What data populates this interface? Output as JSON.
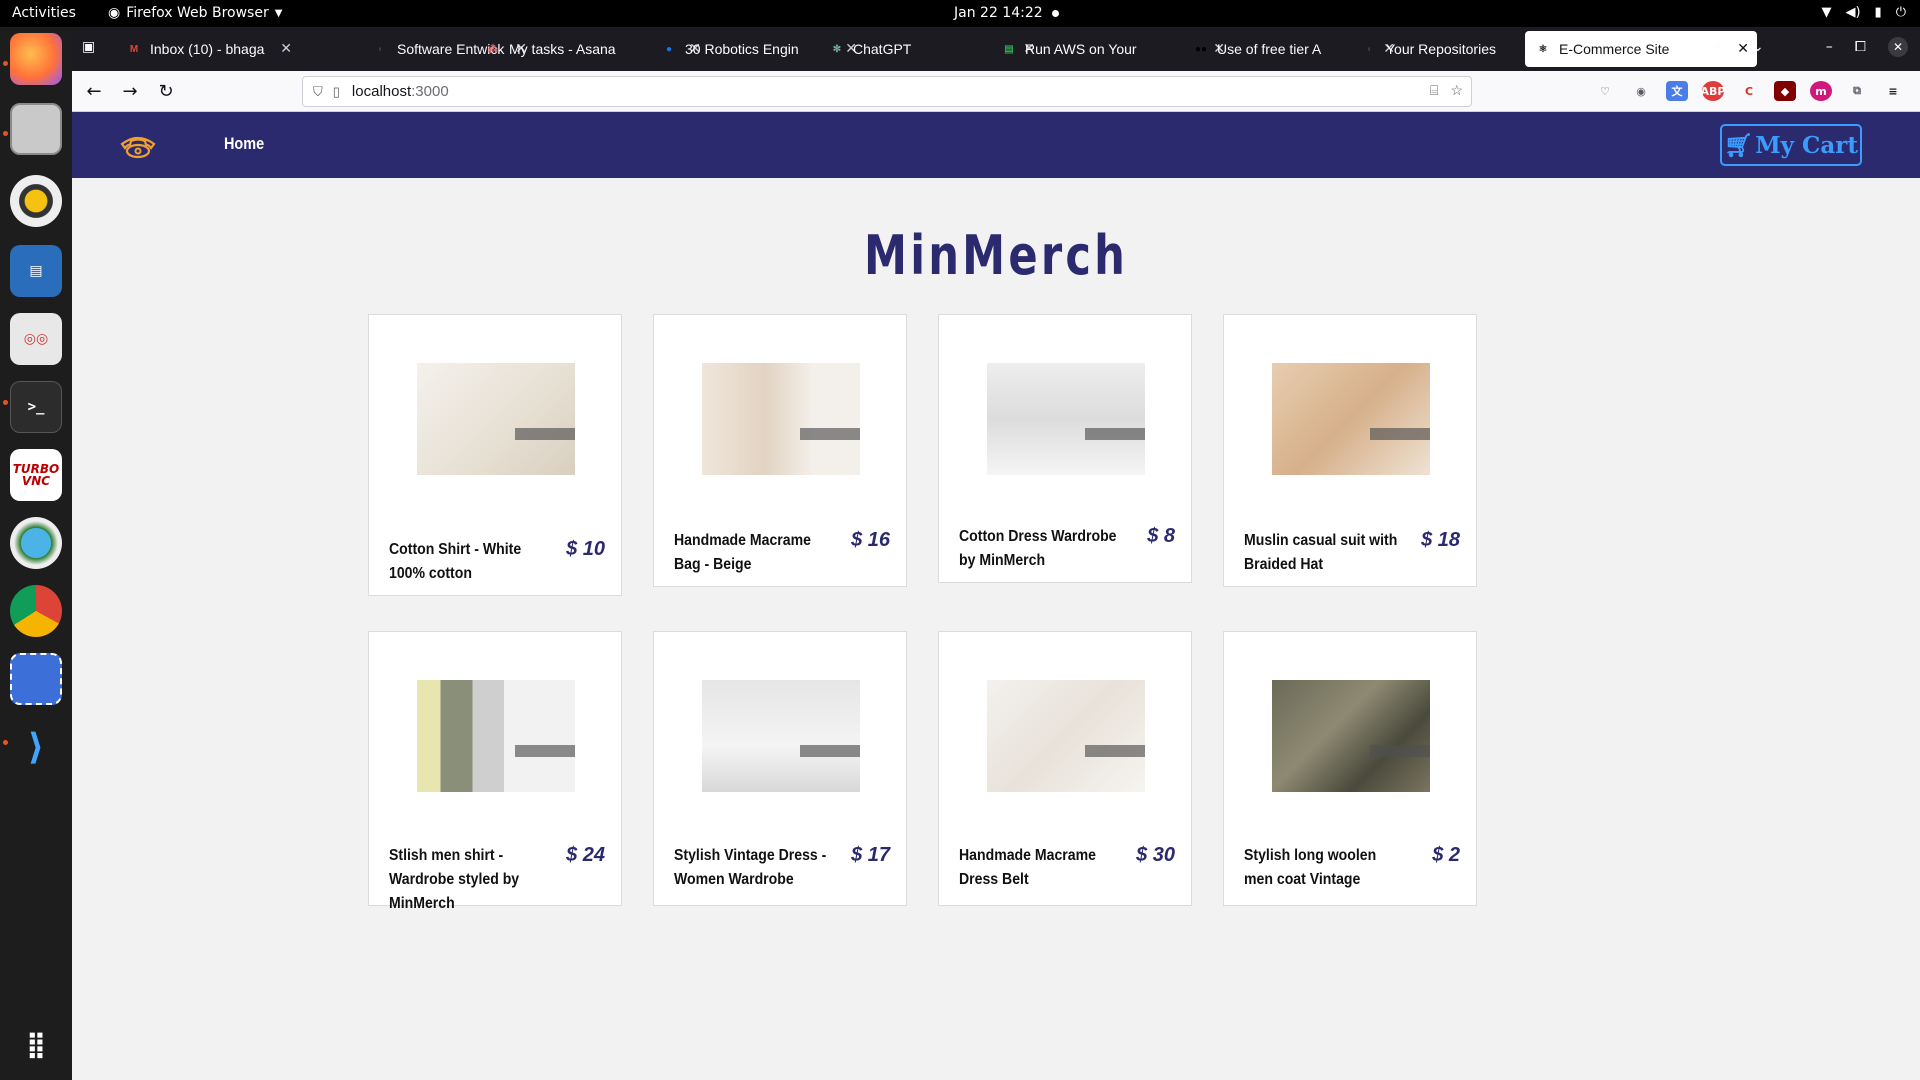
{
  "system": {
    "activities": "Activities",
    "app_name": "Firefox Web Browser",
    "clock": "Jan 22  14:22"
  },
  "browser": {
    "tabs": [
      {
        "title": "Inbox (10) - bhaga",
        "icon": "gmail-icon",
        "color": "#ea4335",
        "glyph": "M"
      },
      {
        "title": "Software Entwick",
        "icon": "github-icon",
        "color": "#3a3a40",
        "glyph": "◐"
      },
      {
        "title": "My tasks - Asana",
        "icon": "asana-icon",
        "color": "#f06a6a",
        "glyph": "⁂"
      },
      {
        "title": "30 Robotics Engin",
        "icon": "blue-circle-icon",
        "color": "#1a73e8",
        "glyph": "●"
      },
      {
        "title": "ChatGPT",
        "icon": "chatgpt-icon",
        "color": "#74aa9c",
        "glyph": "✻"
      },
      {
        "title": "Run AWS on Your",
        "icon": "aws-icon",
        "color": "#2ea44f",
        "glyph": "▤"
      },
      {
        "title": "Use of free tier A",
        "icon": "medium-icon",
        "color": "#000000",
        "glyph": "●●"
      },
      {
        "title": "Your Repositories",
        "icon": "github-icon",
        "color": "#3a3a40",
        "glyph": "◐"
      },
      {
        "title": "E-Commerce Site",
        "icon": "react-icon",
        "color": "#1c1b22",
        "glyph": "⚛"
      }
    ],
    "url_host": "localhost",
    "url_port": ":3000"
  },
  "site": {
    "home": "Home",
    "cart": "My Cart",
    "title": "MinMerch",
    "accent": "#2b2a6f",
    "products": [
      {
        "name": "Cotton Shirt - White 100% cotton",
        "price": "$ 10"
      },
      {
        "name": "Handmade Macrame Bag - Beige",
        "price": "$ 16"
      },
      {
        "name": "Cotton Dress Wardrobe by MinMerch",
        "price": "$ 8"
      },
      {
        "name": "Muslin casual suit with Braided Hat",
        "price": "$ 18"
      },
      {
        "name": "Stlish men shirt - Wardrobe styled by MinMerch",
        "price": "$ 24"
      },
      {
        "name": "Stylish Vintage Dress - Women Wardrobe",
        "price": "$ 17"
      },
      {
        "name": "Handmade Macrame Dress Belt",
        "price": "$ 30"
      },
      {
        "name": "Stylish long woolen men coat Vintage",
        "price": "$ 2"
      }
    ]
  }
}
